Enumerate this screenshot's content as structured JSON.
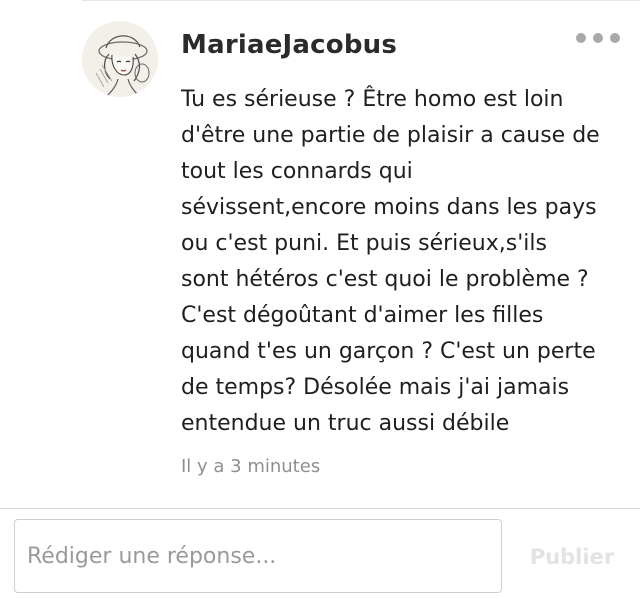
{
  "comment": {
    "author": "MariaeJacobus",
    "text": "Tu es sérieuse ? Être homo est loin\nd'être une partie de plaisir a cause de\ntout les connards qui\nsévissent,encore moins dans les pays\nou c'est puni. Et puis sérieux,s'ils\nsont hétéros c'est quoi le problème ?\nC'est dégoûtant d'aimer les filles\nquand t'es un garçon ? C'est un perte\nde temps? Désolée mais j'ai jamais\nentendue un truc aussi débile",
    "timestamp": "Il y a 3 minutes",
    "more_icon": "more-horizontal-icon"
  },
  "reply": {
    "placeholder": "Rédiger une réponse...",
    "value": "",
    "publish_label": "Publier"
  },
  "colors": {
    "text": "#1f1f1f",
    "muted": "#8f8f8f",
    "disabled": "#e3e3e3",
    "border": "#cfcfcf"
  }
}
